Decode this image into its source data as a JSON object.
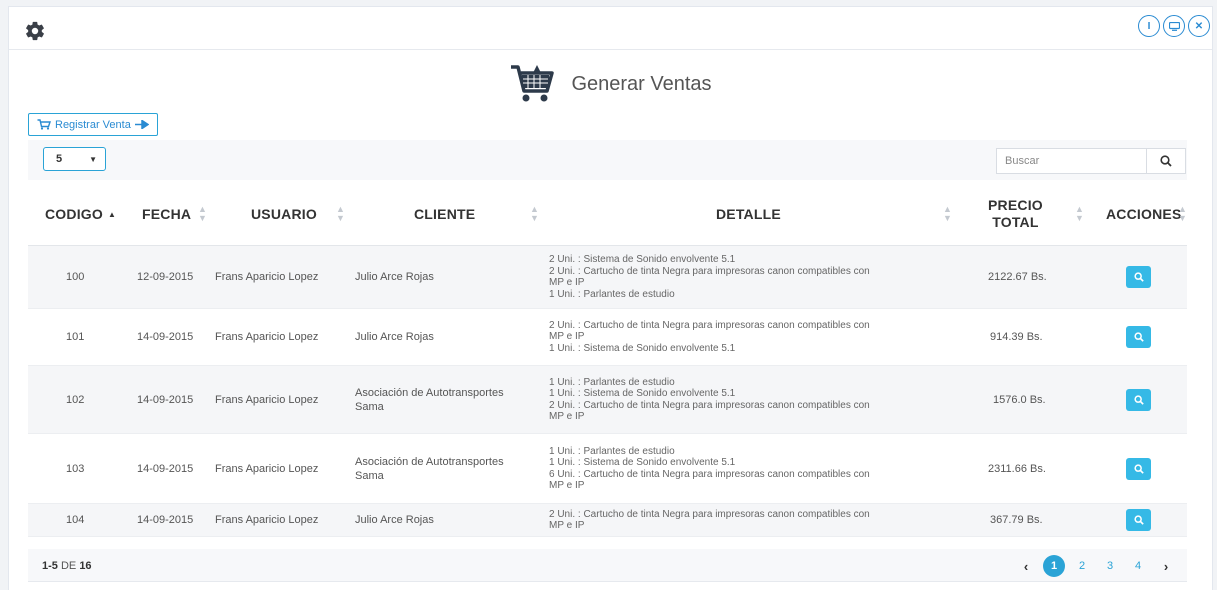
{
  "header": {
    "buttons": [
      {
        "name": "info-icon",
        "glyph": "I"
      },
      {
        "name": "monitor-icon",
        "glyph": ""
      },
      {
        "name": "close-icon",
        "glyph": "✕"
      }
    ]
  },
  "page": {
    "title": "Generar Ventas",
    "register_button": "Registrar Venta"
  },
  "toolbar": {
    "page_size": "5",
    "search_placeholder": "Buscar"
  },
  "table": {
    "columns": [
      "CODIGO",
      "FECHA",
      "USUARIO",
      "CLIENTE",
      "DETALLE",
      "PRECIO TOTAL",
      "ACCIONES"
    ],
    "price_label_line1": "PRECIO",
    "price_label_line2": "TOTAL",
    "rows": [
      {
        "codigo": "100",
        "fecha": "12-09-2015",
        "usuario": "Frans Aparicio Lopez",
        "cliente": "Julio Arce Rojas",
        "detalle": [
          "2 Uni. : Sistema de Sonido envolvente 5.1",
          "2 Uni. : Cartucho de tinta Negra para impresoras canon compatibles con",
          "MP e IP",
          "1 Uni. : Parlantes de estudio"
        ],
        "precio": "2122.67 Bs."
      },
      {
        "codigo": "101",
        "fecha": "14-09-2015",
        "usuario": "Frans Aparicio Lopez",
        "cliente": "Julio Arce Rojas",
        "detalle": [
          "2 Uni. : Cartucho de tinta Negra para impresoras canon compatibles con",
          "MP e IP",
          "1 Uni. : Sistema de Sonido envolvente 5.1"
        ],
        "precio": "914.39 Bs."
      },
      {
        "codigo": "102",
        "fecha": "14-09-2015",
        "usuario": "Frans Aparicio Lopez",
        "cliente": "Asociación de Autotransportes Sama",
        "cliente_lines": [
          "Asociación de Autotransportes",
          "Sama"
        ],
        "detalle": [
          "1 Uni. : Parlantes de estudio",
          "1 Uni. : Sistema de Sonido envolvente 5.1",
          "2 Uni. : Cartucho de tinta Negra para impresoras canon compatibles con",
          "MP e IP"
        ],
        "precio": "1576.0 Bs."
      },
      {
        "codigo": "103",
        "fecha": "14-09-2015",
        "usuario": "Frans Aparicio Lopez",
        "cliente": "Asociación de Autotransportes Sama",
        "cliente_lines": [
          "Asociación de Autotransportes",
          "Sama"
        ],
        "detalle": [
          "1 Uni. : Parlantes de estudio",
          "1 Uni. : Sistema de Sonido envolvente 5.1",
          "6 Uni. : Cartucho de tinta Negra para impresoras canon compatibles con",
          "MP e IP"
        ],
        "precio": "2311.66 Bs."
      },
      {
        "codigo": "104",
        "fecha": "14-09-2015",
        "usuario": "Frans Aparicio Lopez",
        "cliente": "Julio Arce Rojas",
        "detalle": [
          "2 Uni. : Cartucho de tinta Negra para impresoras canon compatibles con",
          "MP e IP"
        ],
        "precio": "367.79 Bs."
      }
    ]
  },
  "footer": {
    "range": "1-5",
    "of_label": "DE",
    "total": "16",
    "pages": [
      "1",
      "2",
      "3",
      "4"
    ],
    "prev": "‹",
    "next": "›"
  },
  "colors": {
    "accent": "#2aa3d6",
    "action_button": "#35b9e6",
    "cart_icon": "#2d3a4a"
  }
}
